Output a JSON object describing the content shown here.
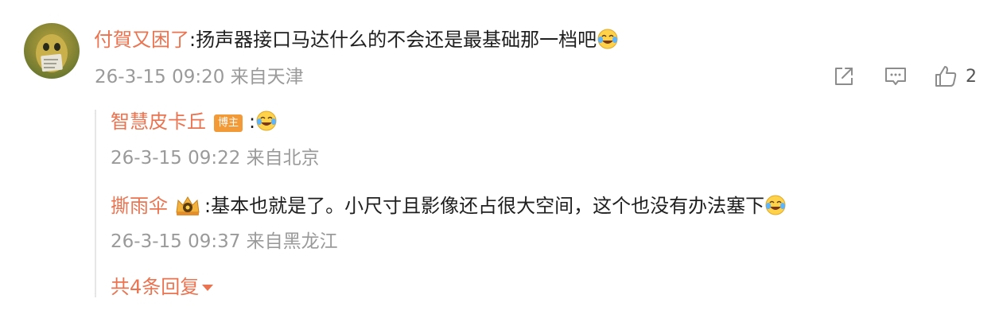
{
  "comment": {
    "username": "付賀又困了",
    "separator": ":",
    "text": "扬声器接口马达什么的不会还是最基础那一档吧",
    "emoji": "laugh-cry-emoji",
    "timestamp": "26-3-15 09:20 来自天津",
    "actions": {
      "share_icon": "share-icon",
      "comment_icon": "comment-icon",
      "like_icon": "thumbs-up-icon",
      "like_count": "2"
    }
  },
  "replies": [
    {
      "username": "智慧皮卡丘",
      "badge": "博主",
      "separator": ":",
      "text": "",
      "emoji": "laugh-cry-emoji",
      "timestamp": "26-3-15 09:22 来自北京"
    },
    {
      "username": "撕雨伞",
      "badge_icon": "crown-badge-icon",
      "separator": ":",
      "text": "基本也就是了。小尺寸且影像还占很大空间，这个也没有办法塞下",
      "emoji": "laugh-cry-emoji",
      "timestamp": "26-3-15 09:37 来自黑龙江"
    }
  ],
  "more_replies": "共4条回复",
  "colors": {
    "accent": "#eb7350",
    "text": "#1f1f1f",
    "meta": "#9a9a9a",
    "badge": "#f29a38"
  }
}
